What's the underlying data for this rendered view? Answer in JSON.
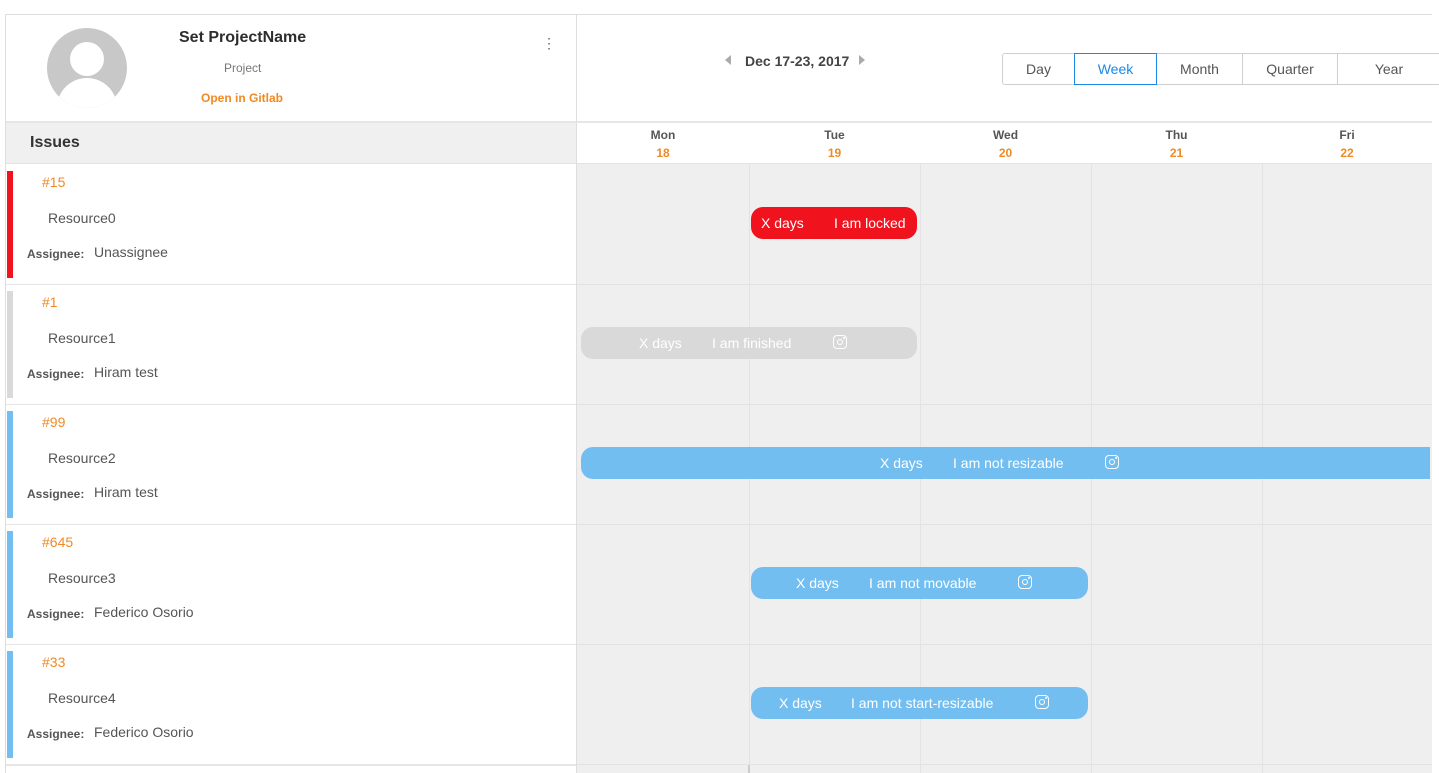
{
  "project": {
    "name": "Set ProjectName",
    "subtitle": "Project",
    "link": "Open in Gitlab",
    "menu_glyph": "⋮"
  },
  "calendar": {
    "range": "Dec 17-23, 2017",
    "modes": [
      "Day",
      "Week",
      "Month",
      "Quarter",
      "Year"
    ],
    "active_mode": "Week",
    "days": [
      {
        "name": "Mon",
        "date": "18"
      },
      {
        "name": "Tue",
        "date": "19"
      },
      {
        "name": "Wed",
        "date": "20"
      },
      {
        "name": "Thu",
        "date": "21"
      },
      {
        "name": "Fri",
        "date": "22"
      }
    ]
  },
  "issues_header": "Issues",
  "assignee_label": "Assignee:",
  "rows": [
    {
      "issue": "#15",
      "resource": "Resource0",
      "assignee": "Unassignee",
      "color": "#f0131e"
    },
    {
      "issue": "#1",
      "resource": "Resource1",
      "assignee": "Hiram test",
      "color": "#d9d9d9"
    },
    {
      "issue": "#99",
      "resource": "Resource2",
      "assignee": "Hiram test",
      "color": "#73bef0"
    },
    {
      "issue": "#645",
      "resource": "Resource3",
      "assignee": "Federico Osorio",
      "color": "#73bef0"
    },
    {
      "issue": "#33",
      "resource": "Resource4",
      "assignee": "Federico Osorio",
      "color": "#73bef0"
    }
  ],
  "tasks": [
    {
      "days": "X days",
      "name": "I am locked",
      "color": "#f0131e",
      "start_day": "Tue",
      "end_day": "Tue",
      "icon": null
    },
    {
      "days": "X days",
      "name": "I am finished",
      "color": "#d9d9d9",
      "start_day": "Mon",
      "end_day": "Tue",
      "icon": "instagram-icon"
    },
    {
      "days": "X days",
      "name": "I am not resizable",
      "color": "#73bef0",
      "start_day": "Mon",
      "end_day": "Fri",
      "icon": "instagram-icon"
    },
    {
      "days": "X days",
      "name": "I am not movable",
      "color": "#73bef0",
      "start_day": "Tue",
      "end_day": "Wed",
      "icon": "instagram-icon"
    },
    {
      "days": "X days",
      "name": "I am not start-resizable",
      "color": "#73bef0",
      "start_day": "Tue",
      "end_day": "Wed",
      "icon": "instagram-icon"
    }
  ]
}
